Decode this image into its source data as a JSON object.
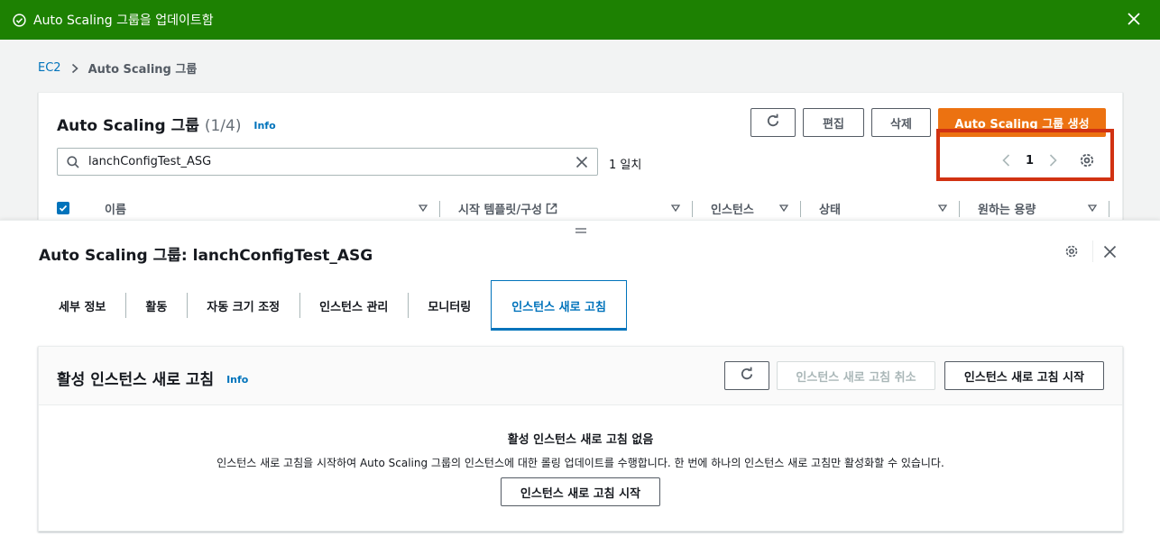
{
  "flash": {
    "message": "Auto Scaling 그룹을 업데이트함",
    "icon": "success-check-icon",
    "color": "#1d8102"
  },
  "breadcrumb": {
    "root": "EC2",
    "current": "Auto Scaling 그룹"
  },
  "list": {
    "title": "Auto Scaling 그룹",
    "count": "(1/4)",
    "info": "Info",
    "buttons": {
      "edit": "편집",
      "delete": "삭제",
      "create": "Auto Scaling 그룹 생성"
    },
    "search": {
      "value": "lanchConfigTest_ASG"
    },
    "match_count": "1 일치",
    "page": "1",
    "columns": [
      "이름",
      "시작 템플릿/구성",
      "인스턴스",
      "상태",
      "원하는 용량"
    ]
  },
  "detail": {
    "title": "Auto Scaling 그룹: lanchConfigTest_ASG",
    "tabs": [
      "세부 정보",
      "활동",
      "자동 크기 조정",
      "인스턴스 관리",
      "모니터링",
      "인스턴스 새로 고침"
    ],
    "active_tab_index": 5,
    "refresh": {
      "title": "활성 인스턴스 새로 고침",
      "info": "Info",
      "cancel_label": "인스턴스 새로 고침 취소",
      "start_label": "인스턴스 새로 고침 시작",
      "empty_title": "활성 인스턴스 새로 고침 없음",
      "empty_desc": "인스턴스 새로 고침을 시작하여 Auto Scaling 그룹의 인스턴스에 대한 롤링 업데이트를 수행합니다. 한 번에 하나의 인스턴스 새로 고침만 활성화할 수 있습니다.",
      "empty_button": "인스턴스 새로 고침 시작"
    }
  },
  "colors": {
    "primary": "#ec7211",
    "link": "#0073bb",
    "highlight": "#d13212"
  }
}
